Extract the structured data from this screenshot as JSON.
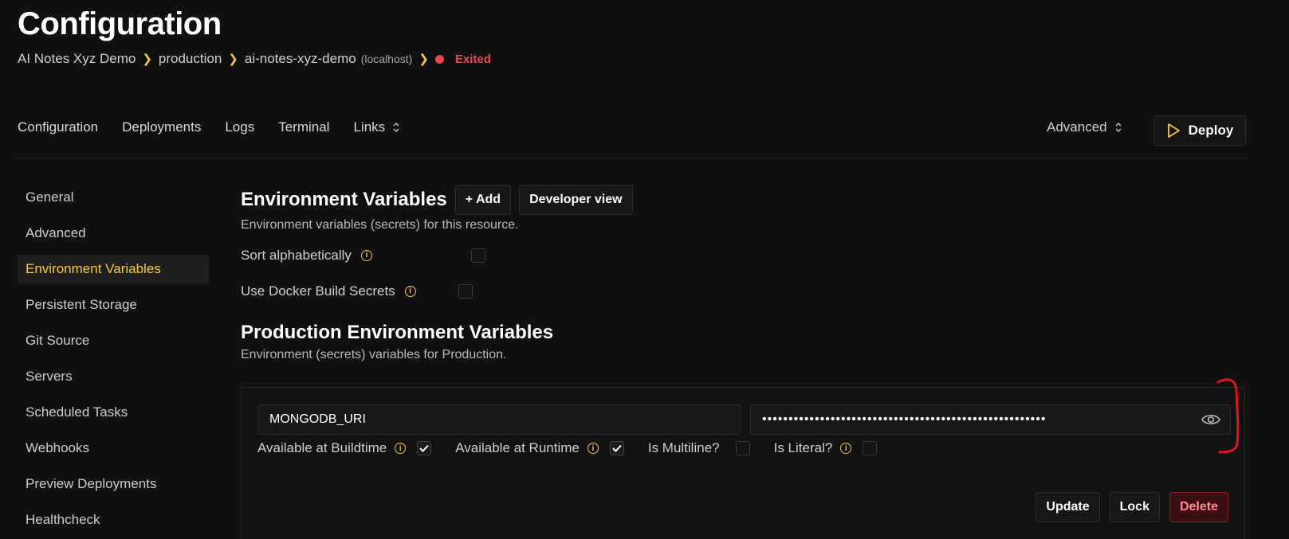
{
  "header": {
    "title": "Configuration",
    "breadcrumb": {
      "project": "AI Notes Xyz Demo",
      "environment": "production",
      "resource": "ai-notes-xyz-demo",
      "server": "(localhost)",
      "status": "Exited"
    }
  },
  "topnav": {
    "items": [
      "Configuration",
      "Deployments",
      "Logs",
      "Terminal",
      "Links"
    ],
    "advanced": "Advanced",
    "deploy": "Deploy"
  },
  "sidebar": {
    "items": [
      "General",
      "Advanced",
      "Environment Variables",
      "Persistent Storage",
      "Git Source",
      "Servers",
      "Scheduled Tasks",
      "Webhooks",
      "Preview Deployments",
      "Healthcheck"
    ],
    "active": "Environment Variables"
  },
  "env": {
    "title": "Environment Variables",
    "add_button": "+ Add",
    "dev_view_button": "Developer view",
    "description": "Environment variables (secrets) for this resource.",
    "sort_label": "Sort alphabetically",
    "docker_secrets_label": "Use Docker Build Secrets"
  },
  "prod": {
    "title": "Production Environment Variables",
    "description": "Environment (secrets) variables for Production.",
    "variable": {
      "key": "MONGODB_URI",
      "masked_value": "••••••••••••••••••••••••••••••••••••••••••••••••••••••",
      "buildtime_label": "Available at Buildtime",
      "runtime_label": "Available at Runtime",
      "multiline_label": "Is Multiline?",
      "literal_label": "Is Literal?",
      "buildtime": true,
      "runtime": true,
      "multiline": false,
      "literal": false
    },
    "actions": {
      "update": "Update",
      "lock": "Lock",
      "delete": "Delete"
    }
  },
  "colors": {
    "accent": "#f5c842",
    "status": "#e5484d",
    "annotation": "#e0141e"
  }
}
